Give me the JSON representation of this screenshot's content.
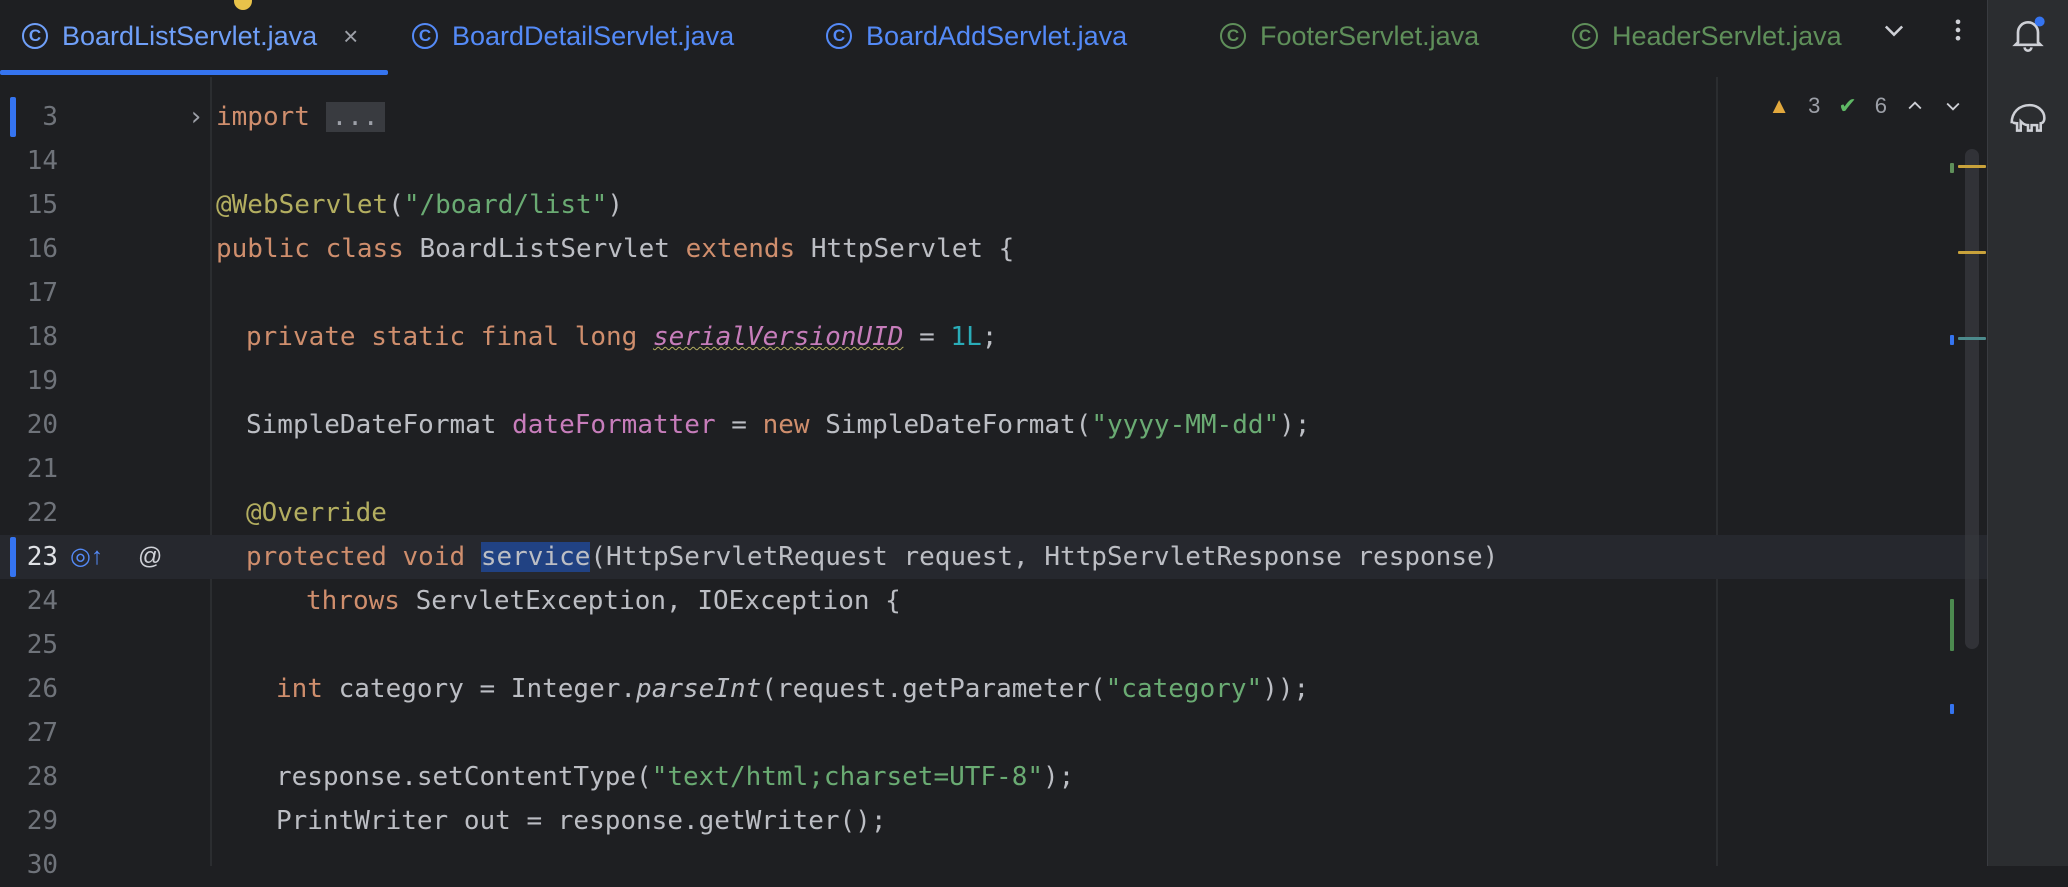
{
  "tabs": [
    {
      "label": "BoardListServlet.java"
    },
    {
      "label": "BoardDetailServlet.java"
    },
    {
      "label": "BoardAddServlet.java"
    },
    {
      "label": "FooterServlet.java"
    },
    {
      "label": "HeaderServlet.java"
    }
  ],
  "tab_close_glyph": "×",
  "tab_icon_glyph": "C",
  "indicators": {
    "warnings": "3",
    "checks": "6"
  },
  "lines": [
    {
      "num": "3"
    },
    {
      "num": "14"
    },
    {
      "num": "15"
    },
    {
      "num": "16"
    },
    {
      "num": "17"
    },
    {
      "num": "18"
    },
    {
      "num": "19"
    },
    {
      "num": "20"
    },
    {
      "num": "21"
    },
    {
      "num": "22"
    },
    {
      "num": "23"
    },
    {
      "num": "24"
    },
    {
      "num": "25"
    },
    {
      "num": "26"
    },
    {
      "num": "27"
    },
    {
      "num": "28"
    },
    {
      "num": "29"
    },
    {
      "num": "30"
    }
  ],
  "code": {
    "l3": {
      "kw": "import",
      "fold": "..."
    },
    "l15": {
      "ann": "@WebServlet",
      "p1": "(",
      "str": "\"/board/list\"",
      "p2": ")"
    },
    "l16": {
      "kw1": "public class",
      "name": " BoardListServlet ",
      "kw2": "extends",
      "rest": " HttpServlet {"
    },
    "l18": {
      "kw": "private static final long ",
      "fld": "serialVersionUID",
      "eq": " = ",
      "num": "1L",
      "end": ";"
    },
    "l20": {
      "type": "SimpleDateFormat ",
      "fld": "dateFormatter",
      "eq": " = ",
      "kw": "new",
      "rest": " SimpleDateFormat(",
      "str": "\"yyyy-MM-dd\"",
      "end": ");"
    },
    "l22": {
      "ann": "@Override"
    },
    "l23": {
      "kw": "protected void ",
      "sel": "service",
      "rest": "(HttpServletRequest request, HttpServletResponse response)"
    },
    "l24": {
      "kw": "throws",
      "rest": " ServletException, IOException {"
    },
    "l26": {
      "kw": "int",
      "a": " category = Integer.",
      "it": "parseInt",
      "b": "(request.getParameter(",
      "str": "\"category\"",
      "end": "));"
    },
    "l28": {
      "a": "response.setContentType(",
      "str": "\"text/html;charset=UTF-8\"",
      "end": ");"
    },
    "l29": {
      "a": "PrintWriter out = response.getWriter();"
    }
  },
  "colors": {
    "accent": "#3574f0",
    "keyword": "#cf8e6d",
    "string": "#6aab73",
    "annotation": "#b3ae60",
    "field": "#c77dbb",
    "number": "#2aacb8"
  }
}
